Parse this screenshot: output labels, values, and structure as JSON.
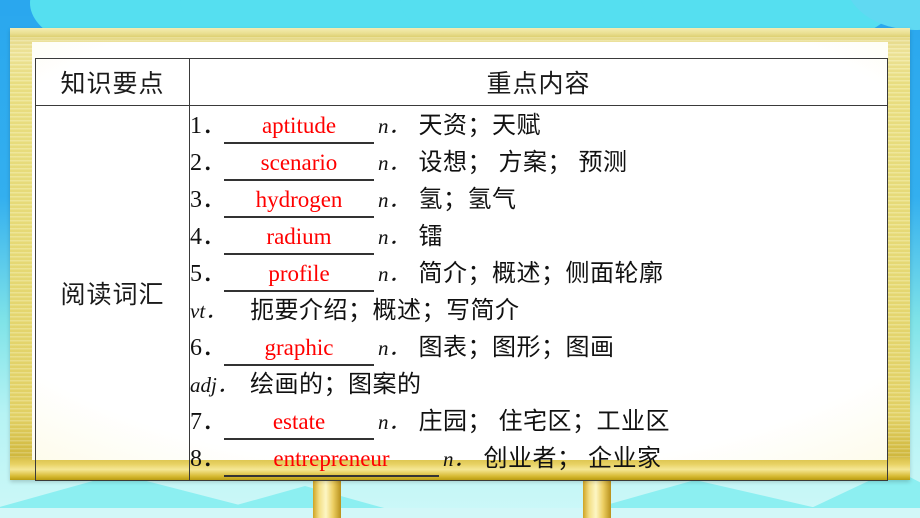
{
  "slide": {
    "background_color": "#33afef",
    "cloud_color": "#55dff0",
    "board_color": "#e9de7c",
    "accent_red": "#ff0000"
  },
  "table": {
    "headers": [
      "知识要点",
      "重点内容"
    ],
    "key_label": "阅读词汇",
    "entries": [
      {
        "num": "1．",
        "word": "aptitude",
        "pos": "n．",
        "meaning": "天资；天赋",
        "width": "std"
      },
      {
        "num": "2．",
        "word": "scenario",
        "pos": "n．",
        "meaning": "设想； 方案； 预测",
        "width": "std"
      },
      {
        "num": "3．",
        "word": "hydrogen",
        "pos": "n．",
        "meaning": "氢；氢气",
        "width": "std"
      },
      {
        "num": "4．",
        "word": "radium",
        "pos": "n．",
        "meaning": "镭",
        "width": "std"
      },
      {
        "num": "5．",
        "word": "profile",
        "pos": "n．",
        "meaning": "简介；概述；侧面轮廓",
        "width": "std"
      },
      {
        "num": "6．",
        "word": "graphic",
        "pos": "n．",
        "meaning": "图表；图形；图画",
        "width": "std"
      },
      {
        "num": "7．",
        "word": "estate",
        "pos": "n．",
        "meaning": "庄园； 住宅区；工业区",
        "width": "std"
      },
      {
        "num": "8．",
        "word": "entrepreneur",
        "pos": "n．",
        "meaning": "创业者； 企业家",
        "width": "wide"
      }
    ],
    "continuations": [
      {
        "after": 5,
        "pos": "vt．",
        "meaning": "扼要介绍；概述；写简介"
      },
      {
        "after": 6,
        "pos": "adj．",
        "meaning": "绘画的；图案的"
      }
    ]
  }
}
